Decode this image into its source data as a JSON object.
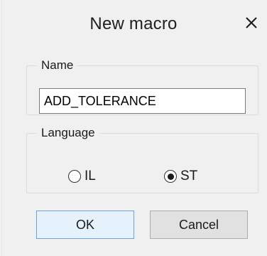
{
  "dialog": {
    "title": "New macro",
    "close_icon": "close-icon",
    "close_glyph": "✕"
  },
  "name_group": {
    "legend": "Name",
    "value": "ADD_TOLERANCE"
  },
  "language_group": {
    "legend": "Language",
    "options": [
      {
        "label": "IL",
        "selected": false
      },
      {
        "label": "ST",
        "selected": true
      }
    ]
  },
  "buttons": {
    "ok_label": "OK",
    "cancel_label": "Cancel"
  },
  "colors": {
    "dialog_bg": "#f0f0f0",
    "ok_bg": "#e5f1fb",
    "ok_border": "#6aa3d6",
    "cancel_bg": "#e1e1e1"
  }
}
